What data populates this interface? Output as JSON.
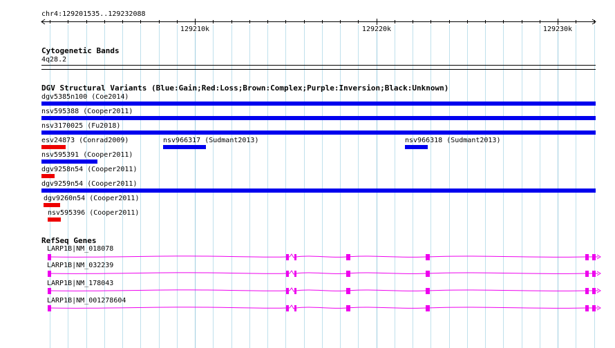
{
  "locus": "chr4:129201535..129232088",
  "ruler": {
    "start": 129201535,
    "end": 129232088,
    "major_ticks": [
      129210000,
      129220000,
      129230000
    ],
    "major_labels": [
      "129210k",
      "129220k",
      "129230k"
    ]
  },
  "cytobands": {
    "title": "Cytogenetic Bands",
    "band": "4q28.2"
  },
  "dgv": {
    "title": "DGV Structural Variants (Blue:Gain;Red:Loss;Brown:Complex;Purple:Inversion;Black:Unknown)",
    "colors": {
      "gain": "#0000ee",
      "loss": "#ee0000"
    },
    "features": [
      {
        "label": "dgv5385n100 (Coe2014)",
        "type": "gain"
      },
      {
        "label": "nsv595388 (Cooper2011)",
        "type": "gain"
      },
      {
        "label": "nsv3170025 (Fu2018)",
        "type": "gain"
      },
      {
        "label": "esv24873 (Conrad2009)",
        "type": "loss"
      },
      {
        "label": "nsv966317 (Sudmant2013)",
        "type": "gain"
      },
      {
        "label": "nsv966318 (Sudmant2013)",
        "type": "gain"
      },
      {
        "label": "nsv595391 (Cooper2011)",
        "type": "gain"
      },
      {
        "label": "dgv9258n54 (Cooper2011)",
        "type": "loss"
      },
      {
        "label": "dgv9259n54 (Cooper2011)",
        "type": "gain"
      },
      {
        "label": "dgv9260n54 (Cooper2011)",
        "type": "loss"
      },
      {
        "label": "nsv595396 (Cooper2011)",
        "type": "loss"
      }
    ]
  },
  "refseq": {
    "title": "RefSeq Genes",
    "color": "#ee00ee",
    "genes": [
      {
        "label": "LARP1B|NM_018078"
      },
      {
        "label": "LARP1B|NM_032239"
      },
      {
        "label": "LARP1B|NM_178043"
      },
      {
        "label": "LARP1B|NM_001278604"
      }
    ]
  }
}
